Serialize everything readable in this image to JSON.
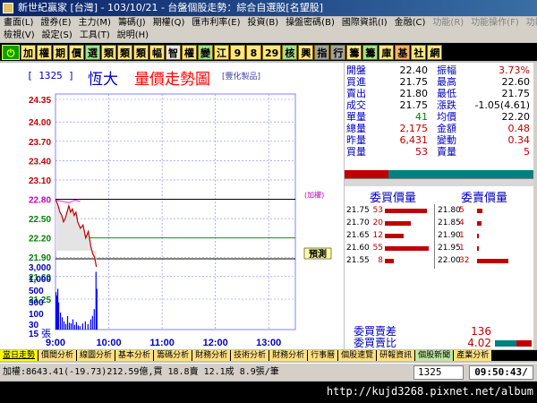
{
  "window": {
    "title": "新世紀贏家 [台灣] - 103/10/21 - 台盤個股走勢：綜合自選股[名望股]"
  },
  "menu1": [
    "畫面(L)",
    "證券(E)",
    "主力(M)",
    "籌碼(J)",
    "期權(Q)",
    "匯市利率(E)",
    "投資(B)",
    "操盤密碼(B)",
    "國際資訊(I)",
    "金融(C)",
    "功能(R)",
    "功能操作(F)",
    "功能操作(F)"
  ],
  "menu2": [
    "檢視(V)",
    "設定(S)",
    "工具(T)",
    "說明(H)"
  ],
  "toolbar": {
    "exit": "⏻",
    "buttons": [
      {
        "label": "加",
        "c": "y"
      },
      {
        "label": "權",
        "c": "y"
      },
      {
        "label": "期",
        "c": "y"
      },
      {
        "label": "價",
        "c": "y"
      },
      {
        "label": "選",
        "c": "g"
      },
      {
        "label": "類",
        "c": "y"
      },
      {
        "label": "類",
        "c": "y"
      },
      {
        "label": "類",
        "c": "y"
      },
      {
        "label": "幅",
        "c": "y"
      },
      {
        "label": "智",
        "c": "w"
      },
      {
        "label": "權",
        "c": "y"
      },
      {
        "label": "變",
        "c": "g"
      },
      {
        "label": "江",
        "c": "y"
      },
      {
        "label": "9",
        "c": "y"
      },
      {
        "label": "8",
        "c": "y"
      },
      {
        "label": "29",
        "c": "y"
      },
      {
        "label": "核",
        "c": "g"
      },
      {
        "label": "興",
        "c": "y"
      },
      {
        "label": "指",
        "c": "gr"
      },
      {
        "label": "行",
        "c": "gr"
      },
      {
        "label": "籌",
        "c": "y"
      },
      {
        "label": "籌",
        "c": "g"
      },
      {
        "label": "庫",
        "c": "y"
      },
      {
        "label": "基",
        "c": "o"
      },
      {
        "label": "社",
        "c": "y"
      },
      {
        "label": "網",
        "c": "y"
      }
    ]
  },
  "stock": {
    "code": "[ 1325 ]",
    "name": "恆大",
    "chart_title": "量價走勢圖",
    "product_tag": "[豐化製品]"
  },
  "chart_data": {
    "type": "line",
    "price_axis": {
      "ticks": [
        "24.35",
        "24.00",
        "23.70",
        "23.40",
        "23.10",
        "22.80",
        "22.50",
        "22.20",
        "21.90",
        "21.60",
        "21.25"
      ],
      "range": [
        21.25,
        24.35
      ]
    },
    "volume_axis": {
      "ticks": [
        "3,000",
        "1,000",
        "500",
        "300",
        "100",
        "30",
        "15"
      ],
      "unit": "張"
    },
    "time_ticks": [
      "9:00",
      "10:00",
      "11:00",
      "12:00",
      "13:00"
    ],
    "ref_price": 22.8,
    "ref_label": "(加權)",
    "avg_price": 22.2,
    "price_series": [
      [
        0,
        22.8
      ],
      [
        3,
        22.7
      ],
      [
        5,
        22.6
      ],
      [
        7,
        22.55
      ],
      [
        9,
        22.45
      ],
      [
        11,
        22.5
      ],
      [
        13,
        22.6
      ],
      [
        15,
        22.7
      ],
      [
        17,
        22.6
      ],
      [
        19,
        22.65
      ],
      [
        21,
        22.55
      ],
      [
        23,
        22.6
      ],
      [
        25,
        22.45
      ],
      [
        28,
        22.35
      ],
      [
        31,
        22.4
      ],
      [
        34,
        22.2
      ],
      [
        37,
        22.3
      ],
      [
        40,
        22.05
      ],
      [
        42,
        21.95
      ],
      [
        44,
        21.9
      ],
      [
        46,
        21.75
      ]
    ],
    "index_series": [
      [
        0,
        22.8
      ],
      [
        8,
        22.78
      ],
      [
        15,
        22.76
      ],
      [
        22,
        22.8
      ],
      [
        28,
        22.78
      ]
    ],
    "volume_bars": [
      {
        "t": 0,
        "v": 55
      },
      {
        "t": 1,
        "v": 50
      },
      {
        "t": 2,
        "v": 60
      },
      {
        "t": 3,
        "v": 40
      },
      {
        "t": 5,
        "v": 25
      },
      {
        "t": 7,
        "v": 18
      },
      {
        "t": 9,
        "v": 12
      },
      {
        "t": 11,
        "v": 8
      },
      {
        "t": 13,
        "v": 20
      },
      {
        "t": 15,
        "v": 10
      },
      {
        "t": 17,
        "v": 9
      },
      {
        "t": 19,
        "v": 15
      },
      {
        "t": 21,
        "v": 7
      },
      {
        "t": 23,
        "v": 11
      },
      {
        "t": 25,
        "v": 6
      },
      {
        "t": 27,
        "v": 5
      },
      {
        "t": 30,
        "v": 9
      },
      {
        "t": 33,
        "v": 12
      },
      {
        "t": 36,
        "v": 8
      },
      {
        "t": 39,
        "v": 15
      },
      {
        "t": 41,
        "v": 20
      },
      {
        "t": 43,
        "v": 30
      },
      {
        "t": 45,
        "v": 85
      },
      {
        "t": 46,
        "v": 60
      }
    ],
    "time_range": [
      0,
      270
    ],
    "note": "預測"
  },
  "quote": [
    {
      "l1": "開盤",
      "v1": "22.40",
      "c1": "#000000",
      "l2": "振幅",
      "v2": "3.73%",
      "c2": "#c00000"
    },
    {
      "l1": "買進",
      "v1": "21.75",
      "c1": "#000000",
      "l2": "最高",
      "v2": "22.60",
      "c2": "#000000"
    },
    {
      "l1": "賣出",
      "v1": "21.80",
      "c1": "#000000",
      "l2": "最低",
      "v2": "21.75",
      "c2": "#000000"
    },
    {
      "l1": "成交",
      "v1": "21.75",
      "c1": "#000000",
      "l2": "漲跌",
      "v2": "-1.05(4.61)",
      "c2": "#000000"
    },
    {
      "l1": "單量",
      "v1": "41",
      "c1": "#008000",
      "l2": "均價",
      "v2": "22.20",
      "c2": "#000000"
    },
    {
      "l1": "總量",
      "v1": "2,175",
      "c1": "#c00000",
      "l2": "金額",
      "v2": "0.48",
      "c2": "#c00000"
    },
    {
      "l1": "昨量",
      "v1": "6,431",
      "c1": "#c00000",
      "l2": "變動",
      "v2": "0.34",
      "c2": "#c00000"
    },
    {
      "l1": "買量",
      "v1": "53",
      "c1": "#c00000",
      "l2": "賣量",
      "v2": "5",
      "c2": "#c00000"
    }
  ],
  "orderbook": {
    "bid_header": "委買價量",
    "ask_header": "委賣價量",
    "bid_ratio": 0.23,
    "rows": [
      {
        "bp": "21.75",
        "bv": "53",
        "bw": 0.9,
        "ap": "21.80",
        "av": "5",
        "aw": 0.1
      },
      {
        "bp": "21.70",
        "bv": "20",
        "bw": 0.55,
        "ap": "21.85",
        "av": "4",
        "aw": 0.08
      },
      {
        "bp": "21.65",
        "bv": "12",
        "bw": 0.4,
        "ap": "21.90",
        "av": "1",
        "aw": 0.03
      },
      {
        "bp": "21.60",
        "bv": "55",
        "bw": 0.95,
        "ap": "21.95",
        "av": "1",
        "aw": 0.03
      },
      {
        "bp": "21.55",
        "bv": "8",
        "bw": 0.2,
        "ap": "22.00",
        "av": "32",
        "aw": 0.6
      }
    ]
  },
  "diff": [
    {
      "label": "委買賣差",
      "value": "136"
    },
    {
      "label": "委買賣比",
      "value": "4.02"
    }
  ],
  "functabs": [
    {
      "label": "當日走勢",
      "active": true
    },
    {
      "label": "價間分析"
    },
    {
      "label": "線圖分析"
    },
    {
      "label": "基本分析"
    },
    {
      "label": "籌碼分析"
    },
    {
      "label": "財務分析"
    },
    {
      "label": "技術分析"
    },
    {
      "label": "財務分析"
    },
    {
      "label": "行事曆"
    },
    {
      "label": "個股速覽"
    },
    {
      "label": "研報資訊"
    },
    {
      "label": "個股新聞",
      "g": true
    },
    {
      "label": "產業分析"
    }
  ],
  "status": {
    "index": "加權:8643.41(-19.73)212.59億,買 18.8賣 12.1成 8.9張/筆",
    "code": "1325",
    "time": "09:50:43/"
  },
  "watermark": "http://kujd3268.pixnet.net/album",
  "colors": {
    "price": "#c00000",
    "volume": "#0000ff",
    "grid": "#8080ff",
    "ref": "#000000",
    "avg": "#00a000",
    "index": "#ff40ff"
  }
}
